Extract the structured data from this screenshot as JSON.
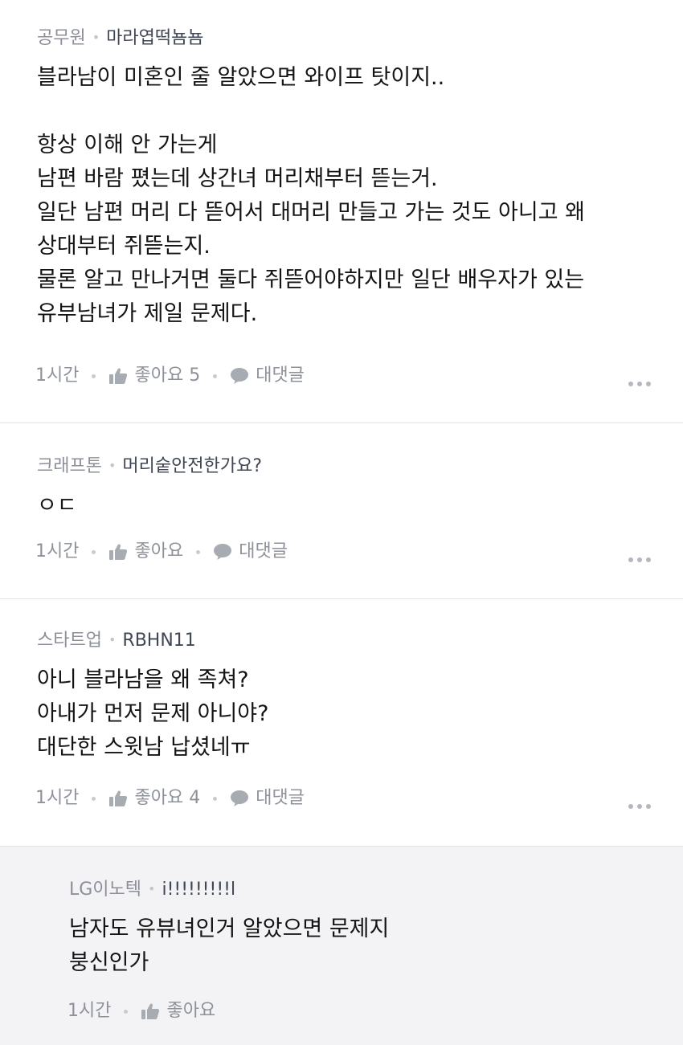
{
  "comments": [
    {
      "company": "공무원",
      "nickname": "마라엽떡뇸뇸",
      "lines": [
        "블라남이 미혼인 줄 알았으면 와이프 탓이지..",
        "",
        "항상 이해 안 가는게",
        "남편 바람 폈는데 상간녀 머리채부터 뜯는거.",
        "일단 남편 머리 다 뜯어서 대머리 만들고 가는 것도 아니고 왜",
        "상대부터 쥐뜯는지.",
        "물론 알고 만나거면 둘다 쥐뜯어야하지만 일단 배우자가 있는",
        "유부남녀가 제일 문제다."
      ],
      "time": "1시간",
      "like_label": "좋아요 5",
      "reply_label": "대댓글"
    },
    {
      "company": "크래프톤",
      "nickname": "머리숱안전한가요?",
      "lines": [
        "ㅇㄷ"
      ],
      "time": "1시간",
      "like_label": "좋아요",
      "reply_label": "대댓글"
    },
    {
      "company": "스타트업",
      "nickname": "RBHN11",
      "lines": [
        "아니 블라남을 왜 족쳐?",
        "아내가 먼저 문제 아니야?",
        "대단한 스윗남 납셨네ㅠ"
      ],
      "time": "1시간",
      "like_label": "좋아요 4",
      "reply_label": "대댓글"
    },
    {
      "company": "LG이노텍",
      "nickname": "i!!!!!!!!!l",
      "lines": [
        "남자도 유뷰녀인거 알았으면 문제지",
        "붕신인가"
      ],
      "time": "1시간",
      "like_label": "좋아요"
    }
  ],
  "icons": {
    "like": "thumbs-up-icon",
    "reply": "speech-bubble-icon",
    "more": "more-dots-icon"
  },
  "colors": {
    "company_text": "#8b8f99",
    "nickname_text": "#3f4754",
    "body_text": "#141414",
    "meta_text": "#8d9199",
    "reply_background": "#f3f3f5",
    "divider": "#e3e3e6"
  }
}
